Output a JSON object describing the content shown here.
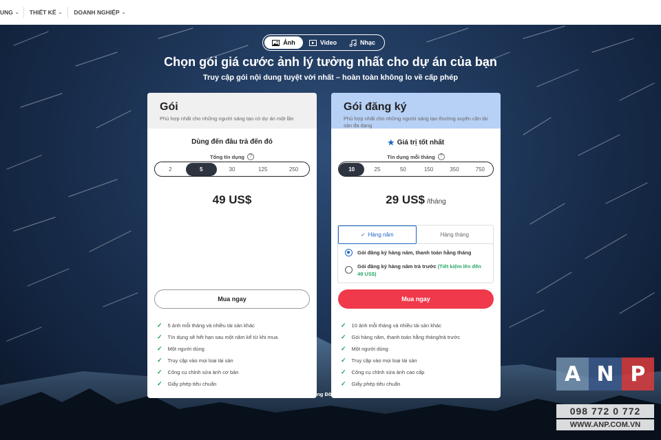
{
  "nav": {
    "items": [
      {
        "label": "UNG",
        "has_dropdown": true
      },
      {
        "label": "THIẾT KẾ",
        "has_dropdown": true
      },
      {
        "label": "DOANH NGHIỆP",
        "has_dropdown": true
      }
    ]
  },
  "media_tabs": [
    {
      "label": "Ảnh",
      "icon": "image-icon",
      "active": true
    },
    {
      "label": "Video",
      "icon": "video-icon",
      "active": false
    },
    {
      "label": "Nhạc",
      "icon": "music-note-icon",
      "active": false
    }
  ],
  "hero": {
    "title": "Chọn gói giá cước ảnh lý tưởng nhất cho dự án của bạn",
    "subtitle": "Truy cập gói nội dung tuyệt vời nhất – hoàn toàn không lo về cấp phép"
  },
  "plans": {
    "pack": {
      "name": "Gói",
      "description": "Phù hợp nhất cho những người sáng tạo có dự án một lần",
      "subheading": "Dùng đến đâu trả đến đó",
      "credits_label": "Tổng tín dụng",
      "credit_options": [
        "2",
        "5",
        "30",
        "125",
        "250"
      ],
      "selected_credit": "5",
      "price": "49 US$",
      "buy_label": "Mua ngay",
      "features": [
        "5 ảnh mỗi tháng và nhiều tài sản khác",
        "Tín dụng sẽ hết hạn sau một năm kể từ khi mua",
        "Một người dùng",
        "Truy cập vào mọi loại tài sản",
        "Công cụ chỉnh sửa ảnh cơ bản",
        "Giấy phép tiêu chuẩn"
      ]
    },
    "subscription": {
      "name": "Gói đăng ký",
      "description": "Phù hợp nhất cho những người sáng tạo thường xuyên cần tài sản đa dạng",
      "subheading": "Giá trị tốt nhất",
      "credits_label": "Tín dụng mỗi tháng",
      "credit_options": [
        "10",
        "25",
        "50",
        "150",
        "350",
        "750"
      ],
      "selected_credit": "10",
      "price": "29 US$",
      "price_period": "/tháng",
      "billing_tabs": [
        "Hàng năm",
        "Hàng tháng"
      ],
      "active_billing_tab": "Hàng năm",
      "billing_options": [
        {
          "label": "Gói đăng ký hàng năm, thanh toán hằng tháng",
          "checked": true
        },
        {
          "label": "Gói đăng ký hàng năm trả trước",
          "savings": "(Tiết kiệm lên đến 49 US$)",
          "checked": false
        }
      ],
      "buy_label": "Mua ngay",
      "features": [
        "10 ảnh mỗi tháng và nhiều tài sản khác",
        "Gói hàng năm, thanh toán hằng tháng/trả trước",
        "Một người dùng",
        "Truy cập vào mọi loại tài sản",
        "Công cụ chỉnh sửa ảnh cao cấp",
        "Giấy phép tiêu chuẩn"
      ]
    }
  },
  "footer_note": "Hiển thị giá bán theo đồng Đô la Mỹ. Có thể phải chịu thuế.",
  "watermark": {
    "letters": [
      "A",
      "N",
      "P"
    ],
    "phone": "098 772 0 772",
    "site": "WWW.ANP.COM.VN"
  },
  "colors": {
    "accent_blue": "#1e63c7",
    "buy_red": "#f0394a",
    "check_green": "#1e9e55",
    "subscription_header": "#b7d0f5"
  }
}
